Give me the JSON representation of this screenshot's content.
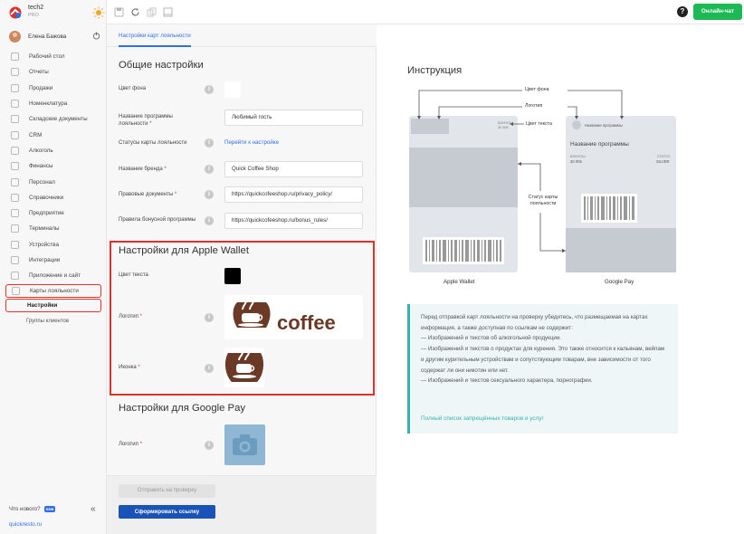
{
  "colors": {
    "accent": "#2f6ee5",
    "primary_button": "#1a53b8",
    "chat_button": "#1db954",
    "highlight": "#e0302a",
    "notice_border": "#38b2ac"
  },
  "brand": {
    "name": "tech2",
    "plan": "PRO"
  },
  "user": {
    "name": "Елена Бажова"
  },
  "sidebar": {
    "items": [
      {
        "label": "Рабочий стол",
        "icon": "dashboard-icon"
      },
      {
        "label": "Отчеты",
        "icon": "chart-icon"
      },
      {
        "label": "Продажи",
        "icon": "cart-icon"
      },
      {
        "label": "Номенклатура",
        "icon": "tag-icon"
      },
      {
        "label": "Складские документы",
        "icon": "document-icon"
      },
      {
        "label": "CRM",
        "icon": "triangle-icon"
      },
      {
        "label": "Алкоголь",
        "icon": "glass-icon"
      },
      {
        "label": "Финансы",
        "icon": "wallet-icon"
      },
      {
        "label": "Персонал",
        "icon": "person-icon"
      },
      {
        "label": "Справочники",
        "icon": "book-icon"
      },
      {
        "label": "Предприятие",
        "icon": "building-icon"
      },
      {
        "label": "Терминалы",
        "icon": "terminal-icon"
      },
      {
        "label": "Устройства",
        "icon": "device-icon"
      },
      {
        "label": "Интеграции",
        "icon": "link-icon"
      },
      {
        "label": "Приложение и сайт",
        "icon": "app-icon"
      },
      {
        "label": "Карты лояльности",
        "icon": "card-icon"
      }
    ],
    "sub_active": "Настройки",
    "sub_other": "Группы клиентов",
    "whats_new": "Что нового?",
    "new_badge": "new",
    "collapse": "«",
    "site": "quickresto.ru"
  },
  "topbar": {
    "help": "?",
    "chat": "Онлайн-чат"
  },
  "tab": {
    "label": "Настройки карт лояльности"
  },
  "general": {
    "title": "Общие настройки",
    "bg_color_label": "Цвет фона",
    "bg_color": "#ffffff",
    "program_name_label": "Название программы лояльности",
    "program_name_value": "Любимый гость",
    "status_label": "Статусы карты лояльности",
    "status_link": "Перейти к настройке",
    "brand_label": "Название бренда",
    "brand_value": "Quick Coffee Shop",
    "legal_label": "Правовые документы",
    "legal_value": "https://quickcofeeshop.ru/privacy_policy/",
    "bonus_label": "Правила бонусной программы",
    "bonus_value": "https://quickcofeeshop.ru/bonus_rules/",
    "req": "*"
  },
  "apple": {
    "title": "Настройки для Apple Wallet",
    "text_color_label": "Цвет текста",
    "text_color": "#000000",
    "logo_label": "Логотип",
    "logo_text": "coffee",
    "icon_label": "Иконка"
  },
  "google": {
    "title": "Настройки для Google Pay",
    "logo_label": "Логотип"
  },
  "buttons": {
    "send_review": "Отправить на проверку",
    "make_link": "Сформировать ссылку"
  },
  "instruction": {
    "title": "Инструкция",
    "callout_bg": "Цвет фона",
    "callout_logo": "Логотип",
    "callout_text": "Цвет текста",
    "callout_status": "Статус карты лояльности",
    "apple_caption": "Apple Wallet",
    "google_caption": "Google Pay",
    "apple_bonus_label": "БОНУСЫ",
    "apple_bonus_value": "30 005",
    "g_program_header": "Название программы",
    "g_program_title": "Название программы",
    "g_bonus_label": "БОНУСЫ",
    "g_bonus_value": "30 005",
    "g_status_label": "СТАТУС",
    "g_status_value": "SILVER"
  },
  "notice": {
    "intro": "Перед отправкой карт лояльности на проверку убедитесь, что размещаемая на картах информация, а также доступная по ссылкам не содержит:",
    "item1": "— Изображений и текстов об алкогольной продукции.",
    "item2": "— Изображений и текстов о продуктах для курения. Это также относится к кальянам, вейпам и другим курительным устройствам и сопутствующим товарам, вне зависимости от того содержат ли они никотин или нет.",
    "item3": "— Изображений и текстов сексуального характера, порнографии.",
    "link": "Полный список запрещённых товаров и услуг"
  }
}
